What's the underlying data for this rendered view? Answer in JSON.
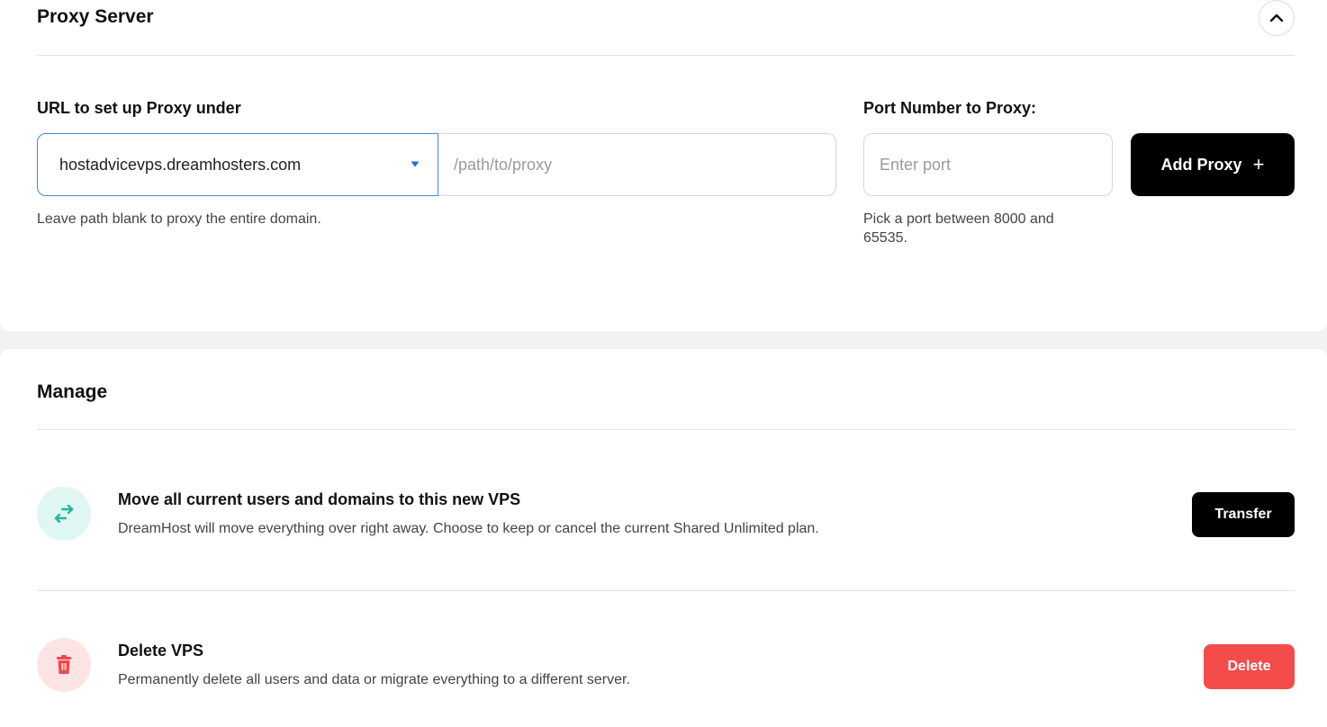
{
  "proxy": {
    "title": "Proxy Server",
    "collapse_icon": "chevron-up-icon",
    "url_label": "URL to set up Proxy under",
    "domain_value": "hostadvicevps.dreamhosters.com",
    "path_placeholder": "/path/to/proxy",
    "path_help": "Leave path blank to proxy the entire domain.",
    "port_label": "Port Number to Proxy:",
    "port_placeholder": "Enter port",
    "port_help": "Pick a port between 8000 and 65535.",
    "add_button": "Add Proxy",
    "add_button_icon": "+"
  },
  "manage": {
    "title": "Manage",
    "rows": [
      {
        "icon": "transfer-arrows-icon",
        "title": "Move all current users and domains to this new VPS",
        "description": "DreamHost will move everything over right away. Choose to keep or cancel the current Shared Unlimited plan.",
        "button": "Transfer"
      },
      {
        "icon": "trash-icon",
        "title": "Delete VPS",
        "description": "Permanently delete all users and data or migrate everything to a different server.",
        "button": "Delete"
      }
    ]
  },
  "colors": {
    "focus_border": "#3f8ed8",
    "primary_button": "#000000",
    "danger_button": "#f44b4b",
    "transfer_icon_bg": "#dff6f2",
    "transfer_icon": "#1fb99a",
    "delete_icon_bg": "#fde4e4",
    "delete_icon": "#f04848"
  }
}
